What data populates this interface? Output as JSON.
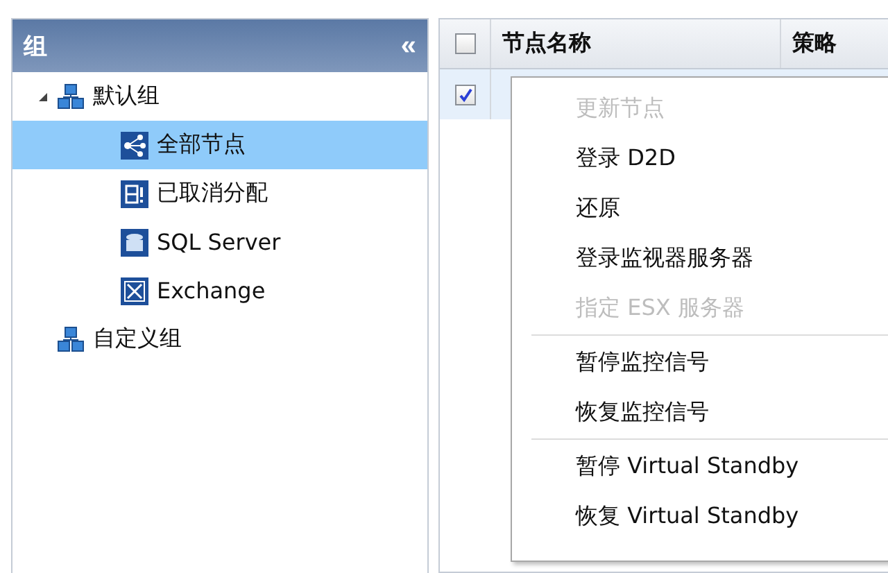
{
  "groups_panel": {
    "title": "组",
    "collapse_glyph": "«",
    "tree": [
      {
        "label": "默认组",
        "kind": "group",
        "expanded": true,
        "selected": false,
        "children": [
          {
            "label": "全部节点",
            "kind": "nodes",
            "selected": true
          },
          {
            "label": "已取消分配",
            "kind": "unassigned",
            "selected": false
          },
          {
            "label": "SQL Server",
            "kind": "sql",
            "selected": false
          },
          {
            "label": "Exchange",
            "kind": "exchange",
            "selected": false
          }
        ]
      },
      {
        "label": "自定义组",
        "kind": "group",
        "selected": false
      }
    ]
  },
  "nodes_table": {
    "header_checked": false,
    "columns": [
      "节点名称",
      "策略"
    ],
    "rows": [
      {
        "checked": true,
        "selected": true
      }
    ]
  },
  "context_menu": {
    "sections": [
      {
        "items": [
          {
            "label": "更新节点",
            "disabled": true
          },
          {
            "label": "登录 D2D",
            "disabled": false
          },
          {
            "label": "还原",
            "disabled": false
          },
          {
            "label": "登录监视器服务器",
            "disabled": false
          },
          {
            "label": "指定 ESX 服务器",
            "disabled": true
          }
        ]
      },
      {
        "items": [
          {
            "label": "暂停监控信号",
            "disabled": false
          },
          {
            "label": "恢复监控信号",
            "disabled": false
          }
        ]
      },
      {
        "items": [
          {
            "label": "暂停 Virtual Standby",
            "disabled": false
          },
          {
            "label": "恢复 Virtual Standby",
            "disabled": false
          }
        ]
      }
    ]
  }
}
